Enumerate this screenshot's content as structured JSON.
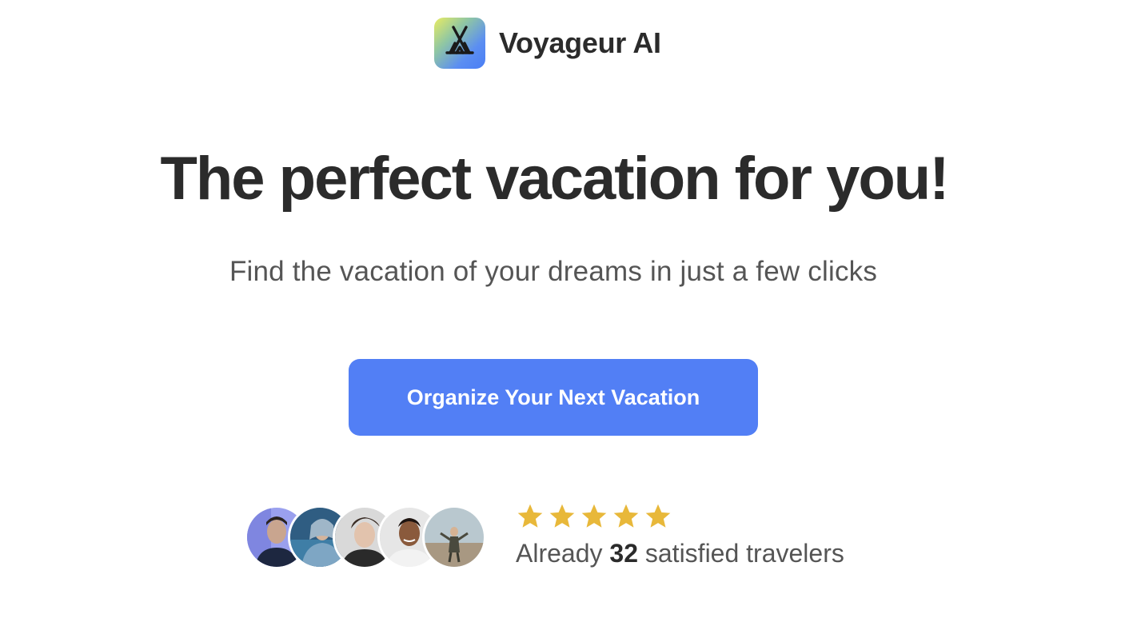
{
  "brand": {
    "name": "Voyageur AI",
    "logo_icon": "tent-icon",
    "logo_gradient": [
      "#e9ec62",
      "#5b8ef2"
    ]
  },
  "hero": {
    "title": "The perfect vacation for you!",
    "subtitle": "Find the vacation of your dreams in just a few clicks"
  },
  "cta": {
    "label": "Organize Your Next Vacation",
    "color": "#527ff5"
  },
  "social_proof": {
    "avatars": [
      {
        "icon": "traveler-avatar-1"
      },
      {
        "icon": "traveler-avatar-2"
      },
      {
        "icon": "traveler-avatar-3"
      },
      {
        "icon": "traveler-avatar-4"
      },
      {
        "icon": "traveler-avatar-5"
      }
    ],
    "rating_stars": 5,
    "star_color": "#e8b83a",
    "text_prefix": "Already ",
    "count": "32",
    "text_suffix": " satisfied travelers"
  }
}
